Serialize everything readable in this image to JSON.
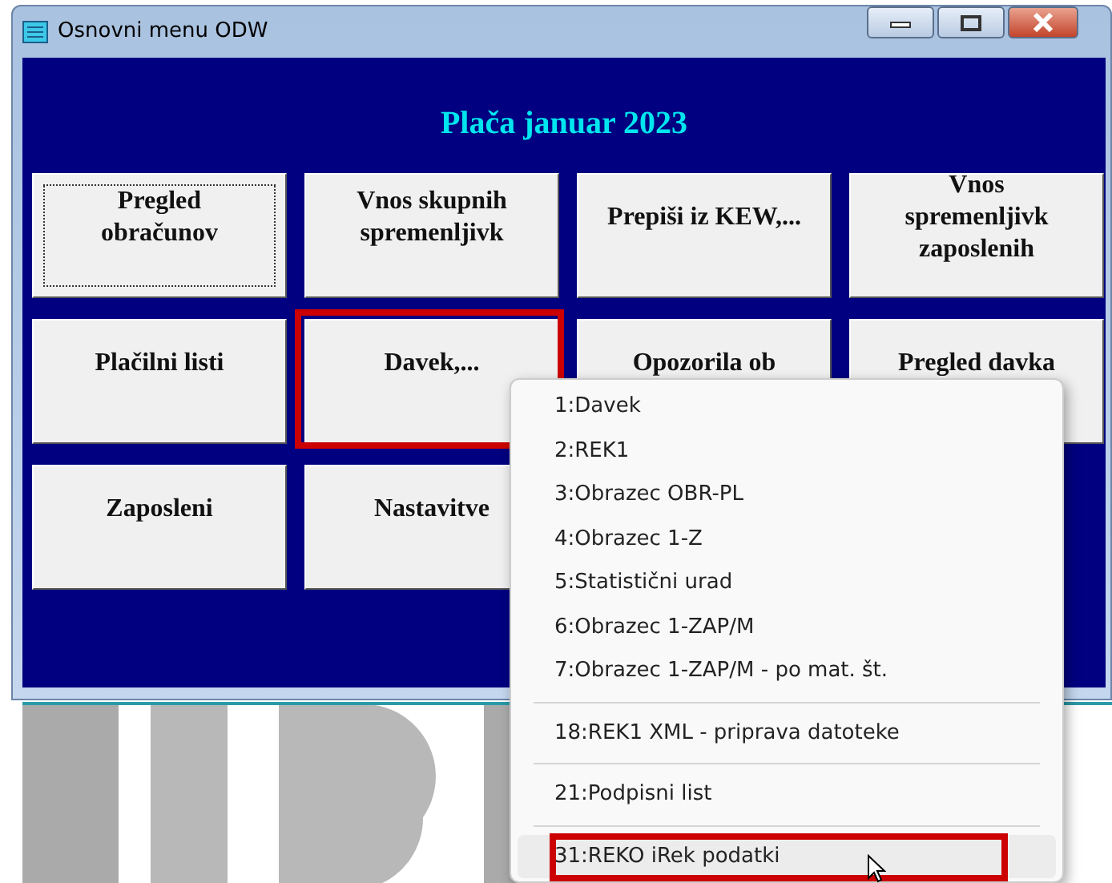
{
  "window": {
    "title": "Osnovni menu ODW"
  },
  "heading": "Plača januar 2023",
  "buttons": [
    {
      "label": "Pregled obračunov",
      "focused": true,
      "annotated": false
    },
    {
      "label": "Vnos skupnih spremenljivk",
      "focused": false,
      "annotated": false
    },
    {
      "label": "Prepiši iz KEW,...",
      "focused": false,
      "annotated": false
    },
    {
      "label": "Vnos spremenljivk zaposlenih",
      "focused": false,
      "annotated": false
    },
    {
      "label": "Plačilni listi",
      "focused": false,
      "annotated": false
    },
    {
      "label": "Davek,...",
      "focused": false,
      "annotated": true
    },
    {
      "label": "Opozorila ob",
      "focused": false,
      "annotated": false
    },
    {
      "label": "Pregled davka",
      "focused": false,
      "annotated": false
    },
    {
      "label": "Zaposleni",
      "focused": false,
      "annotated": false
    },
    {
      "label": "Nastavitve",
      "focused": false,
      "annotated": false
    }
  ],
  "context_menu": {
    "groups": [
      [
        {
          "label": "1:Davek",
          "selected": false,
          "annotated": false
        },
        {
          "label": "2:REK1",
          "selected": false,
          "annotated": false
        },
        {
          "label": "3:Obrazec OBR-PL",
          "selected": false,
          "annotated": false
        },
        {
          "label": "4:Obrazec 1-Z",
          "selected": false,
          "annotated": false
        },
        {
          "label": "5:Statistični urad",
          "selected": false,
          "annotated": false
        },
        {
          "label": "6:Obrazec 1-ZAP/M",
          "selected": false,
          "annotated": false
        },
        {
          "label": "7:Obrazec 1-ZAP/M - po mat. št.",
          "selected": false,
          "annotated": false
        }
      ],
      [
        {
          "label": "18:REK1 XML - priprava datoteke",
          "selected": false,
          "annotated": false
        }
      ],
      [
        {
          "label": "21:Podpisni list",
          "selected": false,
          "annotated": false
        }
      ],
      [
        {
          "label": "31:REKO iRek podatki",
          "selected": true,
          "annotated": true
        }
      ]
    ]
  }
}
